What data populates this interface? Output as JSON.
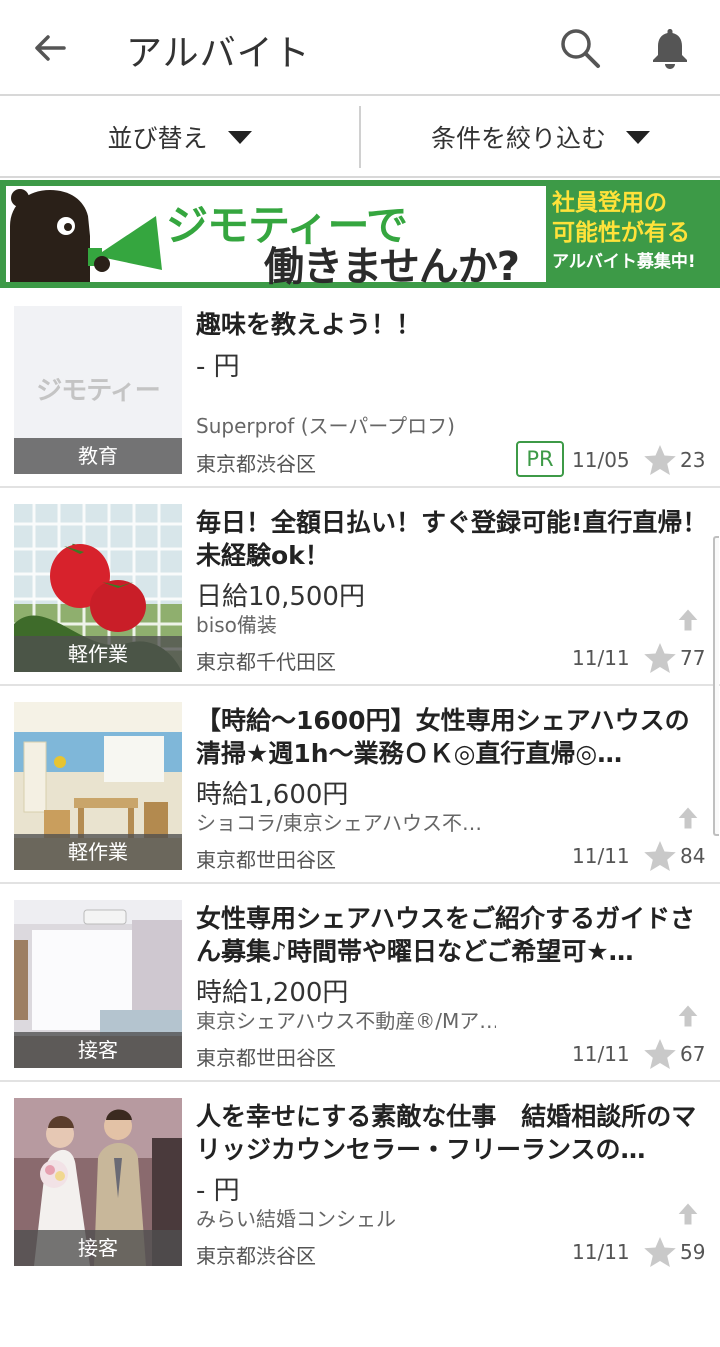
{
  "header": {
    "title": "アルバイト",
    "back_icon": "arrow-left-icon",
    "search_icon": "search-icon",
    "bell_icon": "bell-icon"
  },
  "filters": {
    "sort_label": "並び替え",
    "narrow_label": "条件を絞り込む"
  },
  "banner": {
    "line1": "ジモティーで",
    "line2": "働きませんか?",
    "side1": "社員登用の",
    "side2": "可能性が有る",
    "side3": "アルバイト募集中!",
    "color": "#3d9a47"
  },
  "listings": [
    {
      "title": "趣味を教えよう！！",
      "price": "- 円",
      "company": "Superprof (スーパープロフ)",
      "location": "東京都渋谷区",
      "date": "11/05",
      "favorites": "23",
      "category": "教育",
      "badge": "PR",
      "thumb_logo": "ジモティー"
    },
    {
      "title": "毎日！全額日払い！すぐ登録可能!直行直帰！未経験ok！",
      "price": "日給10,500円",
      "company": "biso備装",
      "location": "東京都千代田区",
      "date": "11/11",
      "favorites": "77",
      "category": "軽作業"
    },
    {
      "title": "【時給～1600円】女性専用シェアハウスの清掃★週1h～業務ＯＫ◎直行直帰◎…",
      "price": "時給1,600円",
      "company": "ショコラ/東京シェアハウス不…",
      "location": "東京都世田谷区",
      "date": "11/11",
      "favorites": "84",
      "category": "軽作業"
    },
    {
      "title": "女性専用シェアハウスをご紹介するガイドさん募集♪時間帯や曜日などご希望可★…",
      "price": "時給1,200円",
      "company": "東京シェアハウス不動産®/Mア…",
      "location": "東京都世田谷区",
      "date": "11/11",
      "favorites": "67",
      "category": "接客"
    },
    {
      "title": "人を幸せにする素敵な仕事　結婚相談所のマリッジカウンセラー・フリーランスの…",
      "price": "- 円",
      "company": "みらい結婚コンシェル",
      "location": "東京都渋谷区",
      "date": "11/11",
      "favorites": "59",
      "category": "接客"
    }
  ]
}
